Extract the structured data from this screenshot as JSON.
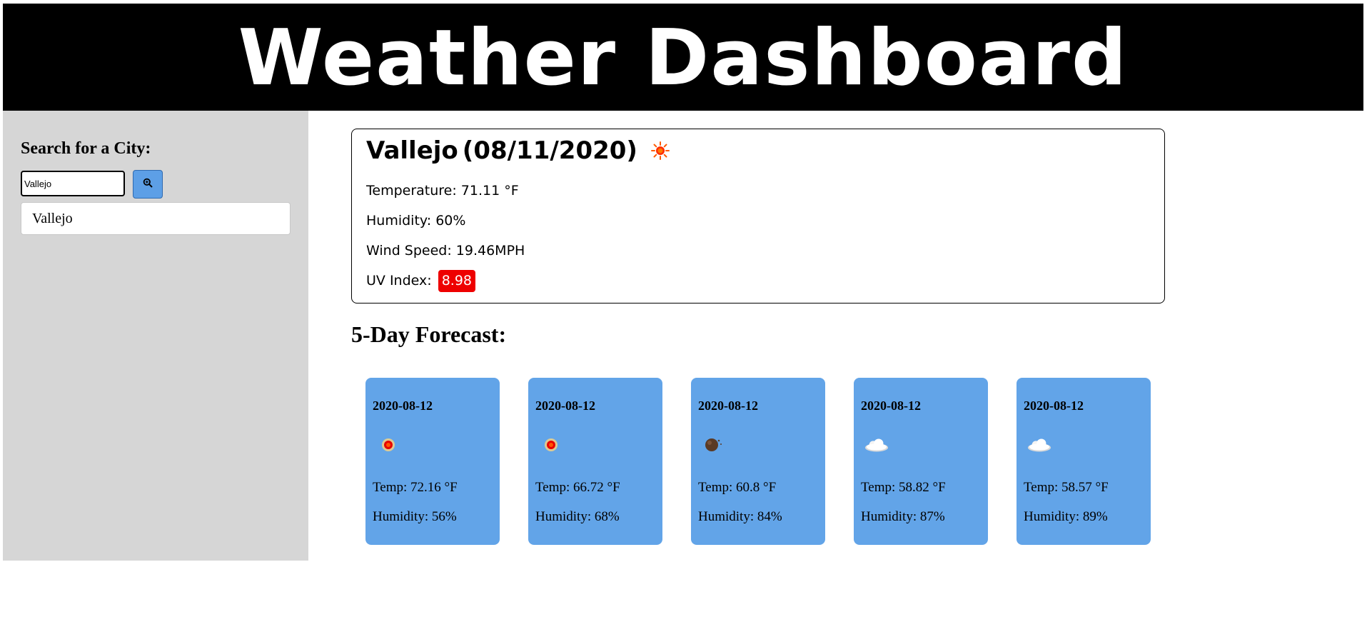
{
  "header": {
    "title": "Weather Dashboard"
  },
  "sidebar": {
    "heading": "Search for a City:",
    "search": {
      "value": "Vallejo",
      "placeholder": ""
    },
    "search_button_icon": "search-icon",
    "history": [
      "Vallejo"
    ]
  },
  "current": {
    "city": "Vallejo",
    "date": "(08/11/2020)",
    "icon": "sun-icon",
    "temperature": "Temperature: 71.11 °F",
    "humidity": "Humidity: 60%",
    "wind": "Wind Speed: 19.46MPH",
    "uv_label": "UV Index:",
    "uv_value": "8.98",
    "uv_color": "#ee0000"
  },
  "forecast": {
    "heading": "5-Day Forecast:",
    "card_color": "#62a4e8",
    "days": [
      {
        "date": "2020-08-12",
        "icon": "sun-icon",
        "temp": "Temp: 72.16 °F",
        "humidity": "Humidity: 56%"
      },
      {
        "date": "2020-08-12",
        "icon": "sun-icon",
        "temp": "Temp: 66.72 °F",
        "humidity": "Humidity: 68%"
      },
      {
        "date": "2020-08-12",
        "icon": "moon-icon",
        "temp": "Temp: 60.8 °F",
        "humidity": "Humidity: 84%"
      },
      {
        "date": "2020-08-12",
        "icon": "cloud-icon",
        "temp": "Temp: 58.82 °F",
        "humidity": "Humidity: 87%"
      },
      {
        "date": "2020-08-12",
        "icon": "cloud-icon",
        "temp": "Temp: 58.57 °F",
        "humidity": "Humidity: 89%"
      }
    ]
  }
}
